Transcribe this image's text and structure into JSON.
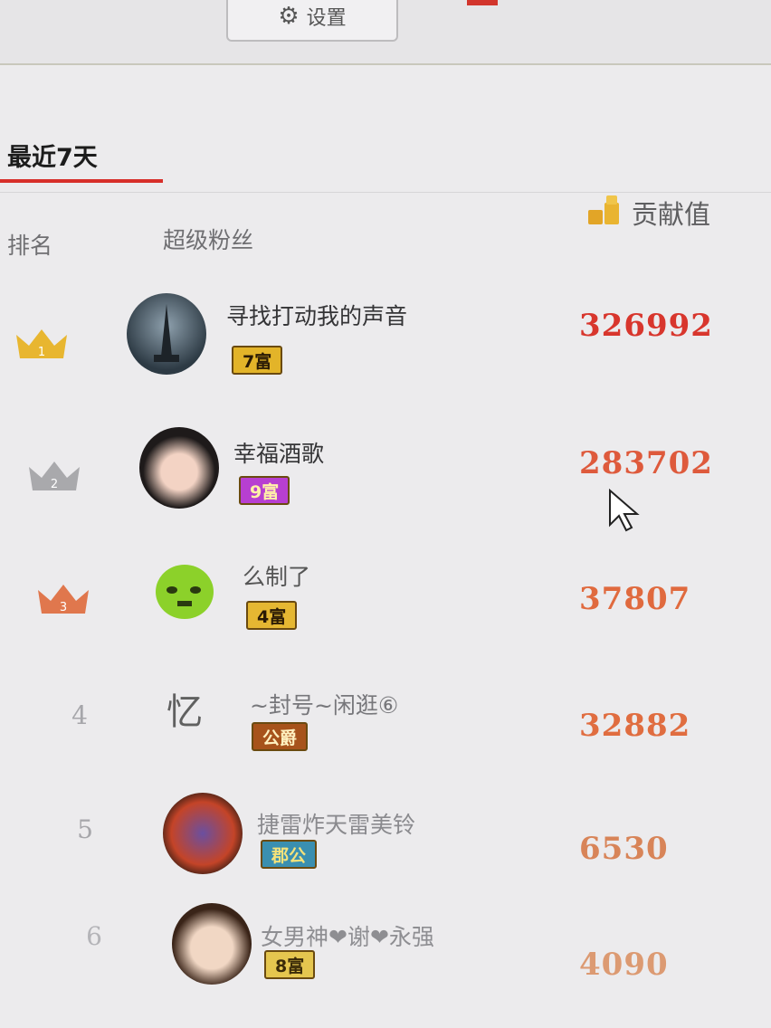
{
  "top": {
    "button_label": "设置"
  },
  "tab": {
    "active_label": "最近7天"
  },
  "columns": {
    "rank": "排名",
    "fan": "超级粉丝",
    "contribution": "贡献值"
  },
  "rows": [
    {
      "rank": "1",
      "name": "寻找打动我的声音",
      "badge": "7富",
      "value": "326992",
      "badge_color": "#e3b429",
      "value_color": "#d8362d",
      "crown_color": "#e8b630"
    },
    {
      "rank": "2",
      "name": "幸福酒歌",
      "badge": "9富",
      "value": "283702",
      "badge_color": "#b73fd1",
      "value_color": "#de5a3c",
      "crown_color": "#a9a9ac"
    },
    {
      "rank": "3",
      "name": "么制了",
      "badge": "4富",
      "value": "37807",
      "badge_color": "#e5b732",
      "value_color": "#e06a3e",
      "crown_color": "#e0774d"
    },
    {
      "rank": "4",
      "name": "~封号~闲逛⑥",
      "badge": "公爵",
      "value": "32882",
      "badge_color": "#a7531b",
      "value_color": "#e06d40"
    },
    {
      "rank": "5",
      "name": "捷雷炸天雷美铃",
      "badge": "郡公",
      "value": "6530",
      "badge_color": "#3a8fb0",
      "value_color": "#d88458"
    },
    {
      "rank": "6",
      "name": "女男神❤谢❤永强",
      "badge": "8富",
      "value": "4090",
      "badge_color": "#e5c64f",
      "value_color": "#dc9a72"
    }
  ]
}
